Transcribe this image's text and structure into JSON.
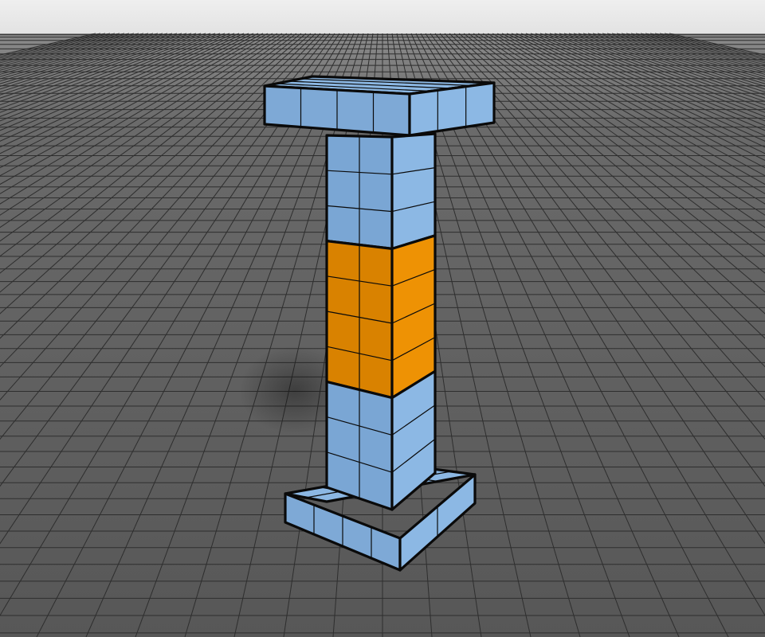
{
  "viewport": {
    "label": "",
    "sky_color": "#ececec",
    "floor_color": "#5c5c5c",
    "floor_grid_color": "#2e2e2e",
    "outline_color": "#0a0a0a"
  },
  "model": {
    "parts": [
      {
        "name": "capital",
        "color": "#8cb8e4",
        "shaded_color": "#7ea9d6"
      },
      {
        "name": "shaft-upper",
        "color": "#8cb8e4",
        "shaded_color": "#7aa6d4",
        "rows": 3
      },
      {
        "name": "shaft-middle",
        "color": "#ee9204",
        "shaded_color": "#d98200",
        "rows": 4
      },
      {
        "name": "shaft-lower",
        "color": "#8cb8e4",
        "shaded_color": "#7aa6d4",
        "rows": 3
      },
      {
        "name": "base",
        "color": "#8cb8e4",
        "shaded_color": "#7ea9d6"
      }
    ]
  }
}
